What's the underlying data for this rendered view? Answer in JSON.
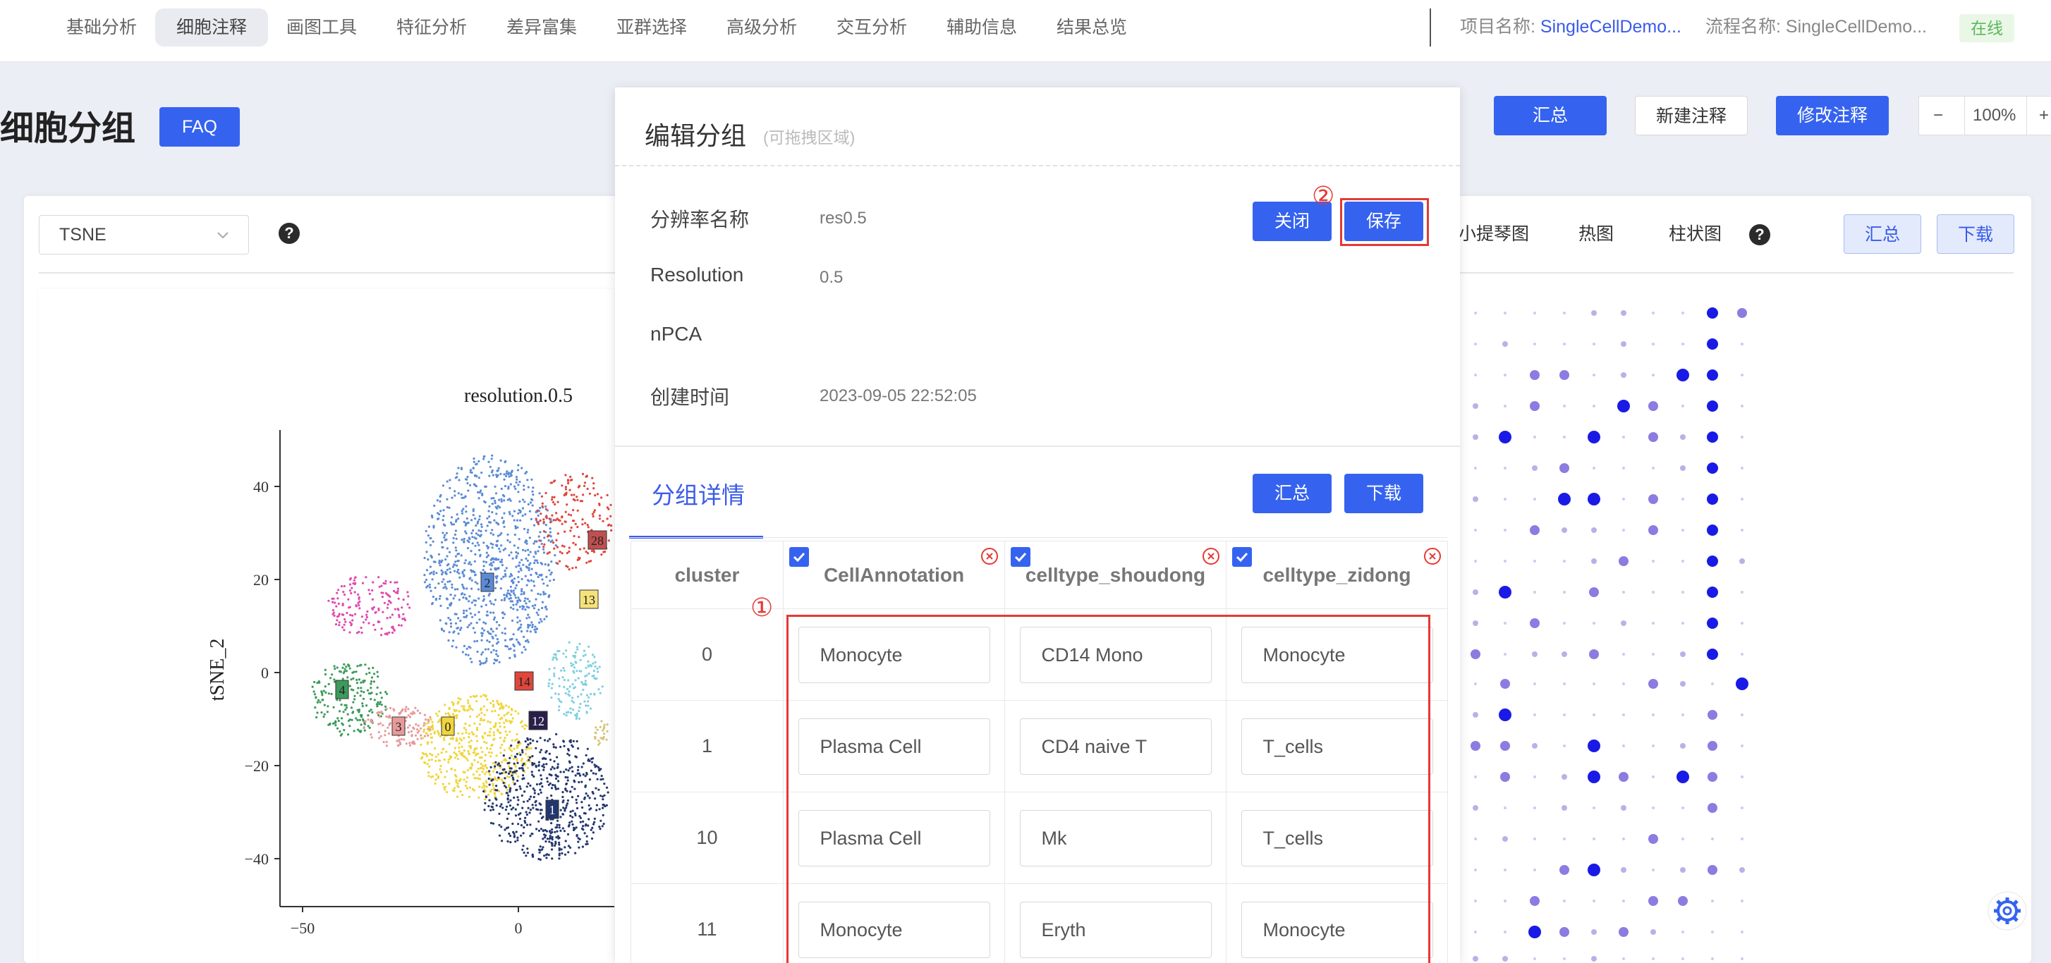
{
  "nav": {
    "items": [
      "基础分析",
      "细胞注释",
      "画图工具",
      "特征分析",
      "差异富集",
      "亚群选择",
      "高级分析",
      "交互分析",
      "辅助信息",
      "结果总览"
    ],
    "active_index": 1,
    "project_label": "项目名称:",
    "project_value": "SingleCellDemo...",
    "flow_label": "流程名称:",
    "flow_value": "SingleCellDemo...",
    "status": "在线"
  },
  "header": {
    "title": "细胞分组",
    "faq": "FAQ",
    "summary": "汇总",
    "new_annotation": "新建注释",
    "modify_annotation": "修改注释",
    "zoom_minus": "−",
    "zoom_value": "100%",
    "zoom_plus": "+"
  },
  "panel": {
    "reduction": "TSNE",
    "help": "?",
    "tabs": [
      "小提琴图",
      "热图",
      "柱状图"
    ],
    "summary": "汇总",
    "download": "下载"
  },
  "plot": {
    "title": "resolution.0.5",
    "ylabel": "tSNE_2",
    "yticks": [
      "40",
      "20",
      "0",
      "−20",
      "−40"
    ],
    "xticks": [
      "−50",
      "0"
    ],
    "cluster_labels": [
      "0",
      "1",
      "2",
      "3",
      "4",
      "12",
      "13",
      "14",
      "28"
    ]
  },
  "modal": {
    "title": "编辑分组",
    "subtitle": "(可拖拽区域)",
    "close": "关闭",
    "save": "保存",
    "fields": [
      {
        "label": "分辨率名称",
        "value": "res0.5"
      },
      {
        "label": "Resolution",
        "value": "0.5"
      },
      {
        "label": "nPCA",
        "value": ""
      },
      {
        "label": "创建时间",
        "value": "2023-09-05 22:52:05"
      }
    ],
    "detail_tab": "分组详情",
    "detail_summary": "汇总",
    "detail_download": "下载",
    "table": {
      "columns": [
        "cluster",
        "CellAnnotation",
        "celltype_shoudong",
        "celltype_zidong"
      ],
      "rows": [
        [
          "0",
          "Monocyte",
          "CD14 Mono",
          "Monocyte"
        ],
        [
          "1",
          "Plasma Cell",
          "CD4 naive T",
          "T_cells"
        ],
        [
          "10",
          "Plasma Cell",
          "Mk",
          "T_cells"
        ],
        [
          "11",
          "Monocyte",
          "Eryth",
          "Monocyte"
        ]
      ]
    },
    "marker_1": "①",
    "marker_2": "②"
  },
  "colors": {
    "primary": "#3563f0",
    "highlight_red": "#e53935",
    "dot_dark": "#1a1ae6",
    "dot_light": "#b9b1e6"
  }
}
